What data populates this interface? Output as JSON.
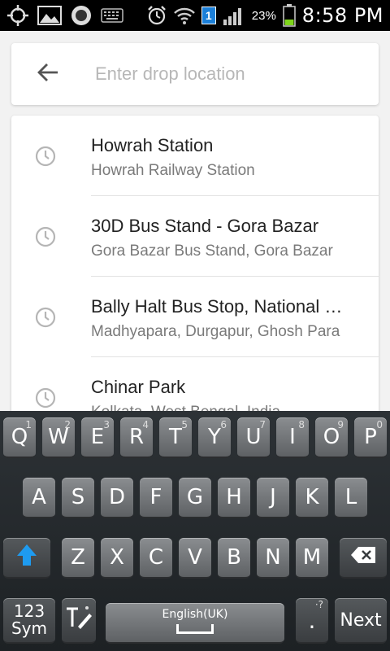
{
  "status_bar": {
    "time": "8:58 PM",
    "battery_percent": "23%",
    "sim_badge": "1",
    "icons": [
      "gps-icon",
      "image-icon",
      "circle-app-icon",
      "keyboard-icon",
      "alarm-icon",
      "wifi-icon",
      "sim-icon",
      "signal-icon",
      "battery-icon"
    ]
  },
  "search": {
    "placeholder": "Enter drop location",
    "value": ""
  },
  "results": [
    {
      "title": "Howrah Station",
      "subtitle": "Howrah Railway Station"
    },
    {
      "title": "30D Bus Stand - Gora Bazar",
      "subtitle": "Gora Bazar Bus Stand, Gora Bazar"
    },
    {
      "title": "Bally Halt Bus Stop, National Highway",
      "subtitle": "Madhyapara, Durgapur, Ghosh Para"
    },
    {
      "title": "Chinar Park",
      "subtitle": "Kolkata, West Bengal, India"
    }
  ],
  "keyboard": {
    "row1": [
      {
        "letter": "Q",
        "num": "1"
      },
      {
        "letter": "W",
        "num": "2"
      },
      {
        "letter": "E",
        "num": "3"
      },
      {
        "letter": "R",
        "num": "4"
      },
      {
        "letter": "T",
        "num": "5"
      },
      {
        "letter": "Y",
        "num": "6"
      },
      {
        "letter": "U",
        "num": "7"
      },
      {
        "letter": "I",
        "num": "8"
      },
      {
        "letter": "O",
        "num": "9"
      },
      {
        "letter": "P",
        "num": "0"
      }
    ],
    "row2": [
      "A",
      "S",
      "D",
      "F",
      "G",
      "H",
      "J",
      "K",
      "L"
    ],
    "row3": [
      "Z",
      "X",
      "C",
      "V",
      "B",
      "N",
      "M"
    ],
    "sym_label_top": "123",
    "sym_label_bottom": "Sym",
    "space_label": "English(UK)",
    "dot_label": ".",
    "dot_sup": "·?",
    "next_label": "Next",
    "shift_color": "#1e9bf0"
  }
}
